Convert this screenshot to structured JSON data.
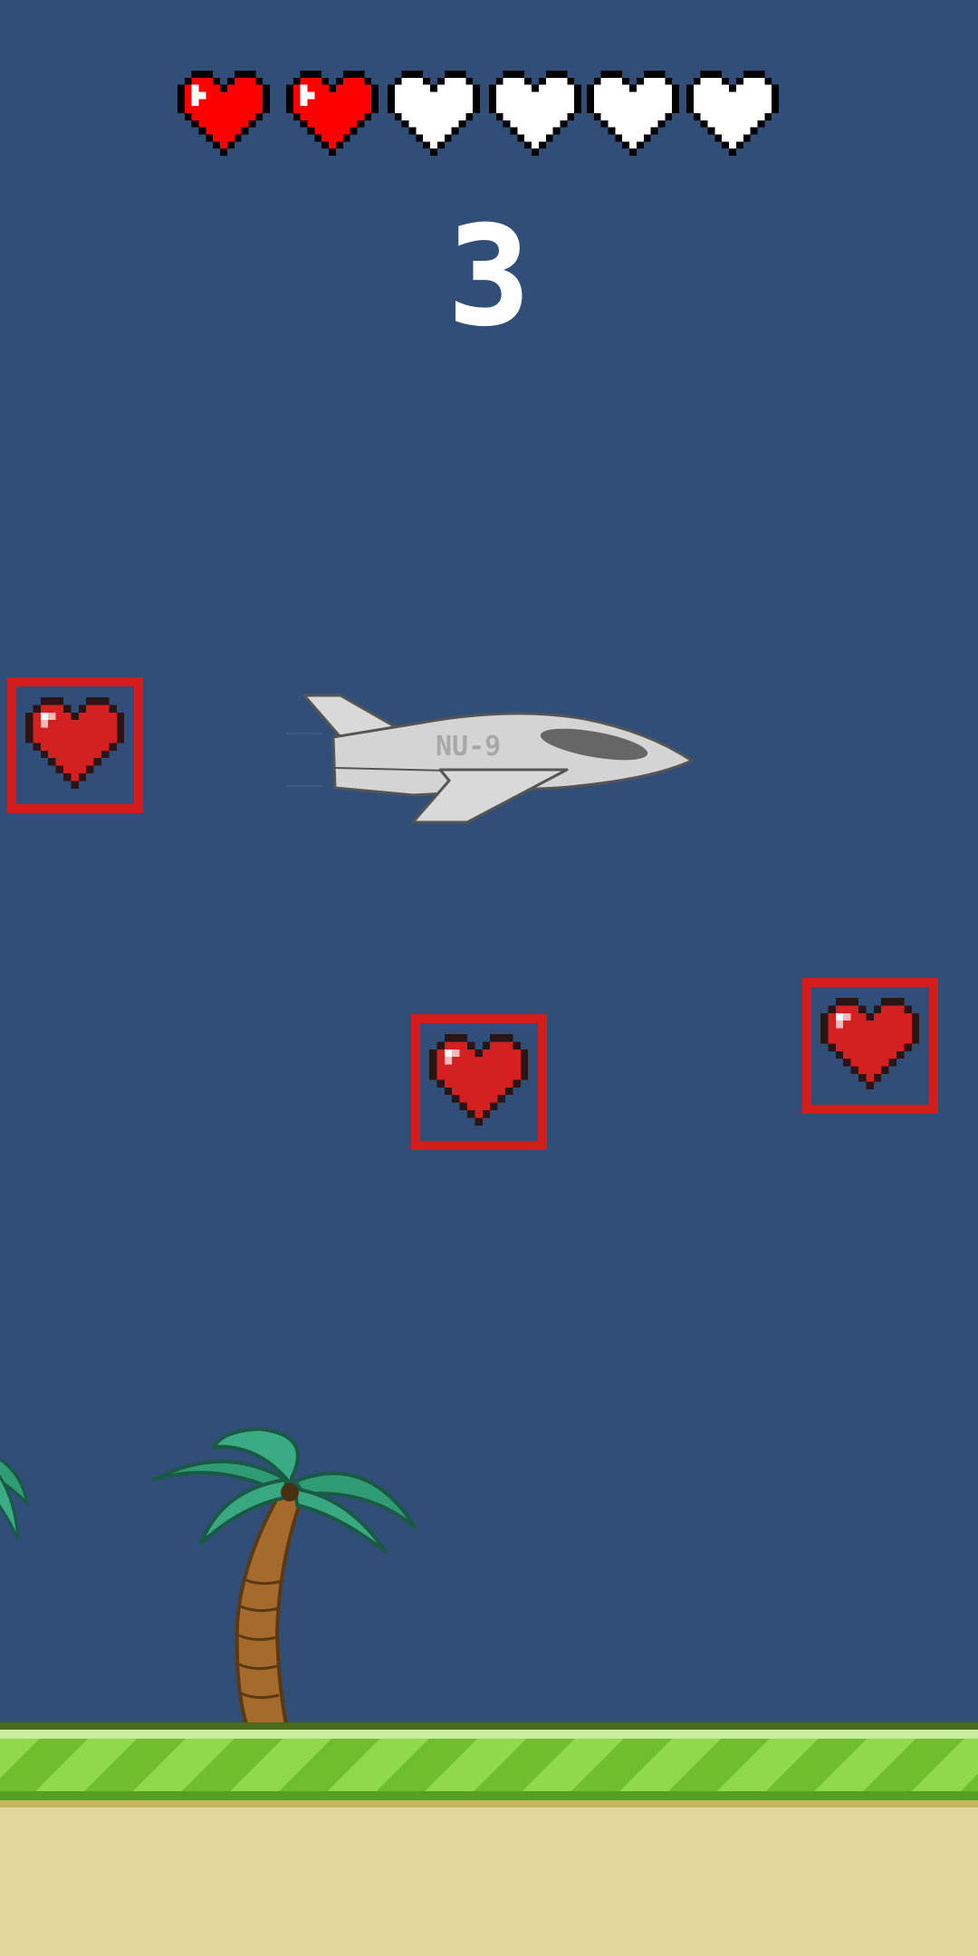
{
  "hud": {
    "lives_total": 6,
    "lives_remaining": 2,
    "full_heart_color": "#ff0000",
    "empty_heart_color": "#ffffff",
    "heart_icon": "pixel-heart-icon"
  },
  "score": {
    "value": "3"
  },
  "player": {
    "sprite": "jet-fighter-icon",
    "tail_marking": "NU-9"
  },
  "pickups": {
    "sprite": "heart-pickup-icon",
    "count": 3,
    "frame_color": "#d41c1c"
  },
  "scenery": {
    "background_color": "#314e79",
    "tree_sprite": "palm-tree-icon",
    "grass_color": "#8fd94a",
    "sand_color": "#e1d99c"
  }
}
